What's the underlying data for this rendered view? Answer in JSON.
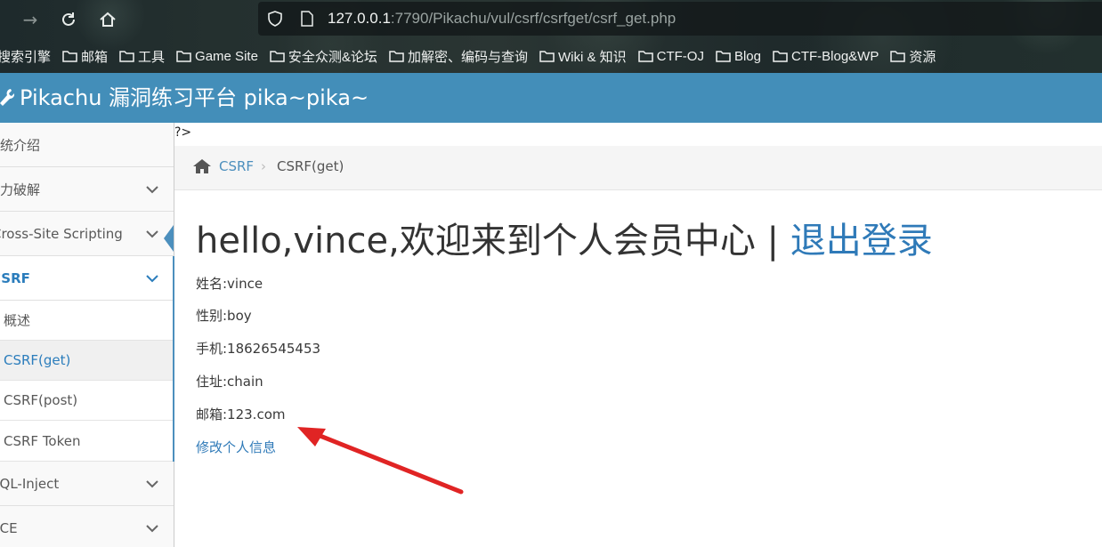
{
  "browser": {
    "url_host": "127.0.0.1",
    "url_path": ":7790/Pikachu/vul/csrf/csrfget/csrf_get.php",
    "bookmarks": [
      {
        "label": "搜索引擎",
        "folder": false
      },
      {
        "label": "邮箱",
        "folder": true
      },
      {
        "label": "工具",
        "folder": true
      },
      {
        "label": "Game Site",
        "folder": true
      },
      {
        "label": "安全众测&论坛",
        "folder": true
      },
      {
        "label": "加解密、编码与查询",
        "folder": true
      },
      {
        "label": "Wiki & 知识",
        "folder": true
      },
      {
        "label": "CTF-OJ",
        "folder": true
      },
      {
        "label": "Blog",
        "folder": true
      },
      {
        "label": "CTF-Blog&WP",
        "folder": true
      },
      {
        "label": "资源",
        "folder": true
      }
    ]
  },
  "header": {
    "title": "Pikachu 漏洞练习平台 pika~pika~"
  },
  "sidebar": {
    "items": [
      {
        "label": "系统介绍"
      },
      {
        "label": "暴力破解"
      },
      {
        "label": "Cross-Site Scripting"
      },
      {
        "label": "CSRF"
      },
      {
        "label": "概述"
      },
      {
        "label": "CSRF(get)"
      },
      {
        "label": "CSRF(post)"
      },
      {
        "label": "CSRF Token"
      },
      {
        "label": "SQL-Inject"
      },
      {
        "label": "RCE"
      }
    ]
  },
  "main": {
    "stray_text": "?>",
    "breadcrumb": {
      "link": "CSRF",
      "current": "CSRF(get)"
    },
    "welcome": "hello,vince,欢迎来到个人会员中心 | ",
    "logout": "退出登录",
    "info": {
      "name": "姓名:vince",
      "sex": "性别:boy",
      "phone": "手机:18626545453",
      "address": "住址:chain",
      "email": "邮箱:123.com"
    },
    "edit_link": "修改个人信息"
  },
  "colors": {
    "header_blue": "#438eb9",
    "link_blue": "#2f7ab8",
    "annotation_red": "#e02424"
  }
}
